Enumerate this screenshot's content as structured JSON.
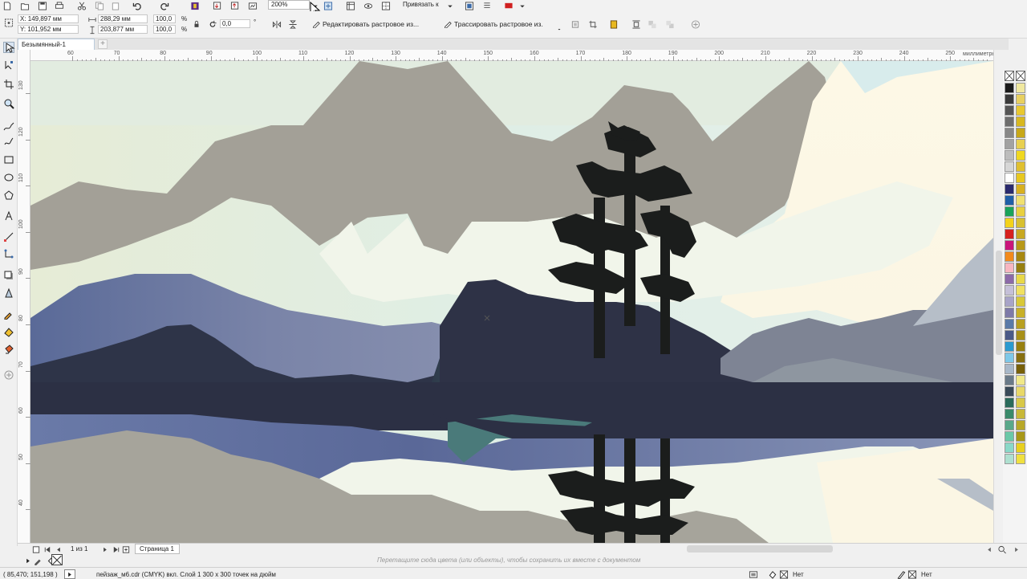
{
  "topbar": {
    "zoom_value": "200%",
    "snap_label": "Привязать к"
  },
  "propbar": {
    "x_value": "X: 149,897 мм",
    "y_value": "Y: 101,952 мм",
    "width_value": "288,29 мм",
    "height_value": "203,877 мм",
    "scale_w": "100,0",
    "scale_h": "100,0",
    "percent": "%",
    "rotation": "0,0",
    "degree": "°",
    "edit_bitmap_label": "Редактировать растровое из...",
    "trace_bitmap_label": "Трассировать растровое из."
  },
  "doc_tab": {
    "title": "Безымянный-1"
  },
  "ruler": {
    "top_ticks": [
      "60",
      "70",
      "80",
      "90",
      "100",
      "110",
      "120",
      "130",
      "140",
      "150",
      "160",
      "170",
      "180",
      "190",
      "200",
      "210",
      "220",
      "230",
      "240",
      "250"
    ],
    "unit": "миллиметры",
    "left_ticks": [
      "130",
      "120",
      "110",
      "100",
      "90",
      "80",
      "70",
      "60",
      "50",
      "40"
    ]
  },
  "pagebar": {
    "page_count": "1 из 1",
    "page_tab": "Страница 1"
  },
  "hint": "Перетащите сюда цвета (или объекты), чтобы сохранить их вместе с документом",
  "statusbar": {
    "coords": "( 85,470; 151,198 )",
    "doc_info": "пейзаж_м6.cdr (CMYK) вкл. Слой 1 300 x 300 точек на дюйм",
    "fill_none": "Нет",
    "outline_none": "Нет"
  },
  "palette": {
    "colors_left": [
      "#1a1a1a",
      "#3a3a3a",
      "#555555",
      "#6e6e6e",
      "#888888",
      "#a2a2a2",
      "#bcbcbc",
      "#d6d6d6",
      "#ffffff",
      "#2a2a6e",
      "#1f5fa8",
      "#1aa35a",
      "#f3d21a",
      "#d6211e",
      "#c9157a",
      "#f28a1c",
      "#f7b6c0",
      "#8c6aa8",
      "#c5c0d8",
      "#a8a4c8",
      "#7e7aa8",
      "#5a7aa8",
      "#4a5a88",
      "#2a9ad0",
      "#7ec8e8",
      "#a8b8c8",
      "#6a7a88",
      "#3a4a58",
      "#2a6a5a",
      "#3a8a6a",
      "#5aa88a",
      "#6ac8a8",
      "#8ad8c8",
      "#aee0d0"
    ],
    "colors_right": [
      "#f0e8a0",
      "#e8d060",
      "#e8c830",
      "#d8b820",
      "#c8a818",
      "#e8d050",
      "#f0d820",
      "#e0c030",
      "#e8c820",
      "#d8b020",
      "#f0e070",
      "#e8d040",
      "#d8c030",
      "#c8a820",
      "#b89818",
      "#a88810",
      "#988010",
      "#e8d848",
      "#f0e060",
      "#d8c838",
      "#c8b028",
      "#b8a020",
      "#a89018",
      "#988010",
      "#887010",
      "#786008",
      "#f0e888",
      "#e8d868",
      "#d8c848",
      "#c8b838",
      "#b8a828",
      "#a89818",
      "#e8d020",
      "#f0e040"
    ]
  },
  "icons": [
    "new-icon",
    "open-icon",
    "save-icon",
    "print-icon",
    "cut-icon",
    "copy-icon",
    "paste-icon",
    "undo-icon",
    "redo-icon",
    "search-icon",
    "import-icon",
    "export-icon",
    "publish-icon",
    "app-launcher-icon",
    "fullscreen-icon",
    "guides-icon",
    "view-icon",
    "snap-icon",
    "options-icon",
    "color-icon"
  ]
}
